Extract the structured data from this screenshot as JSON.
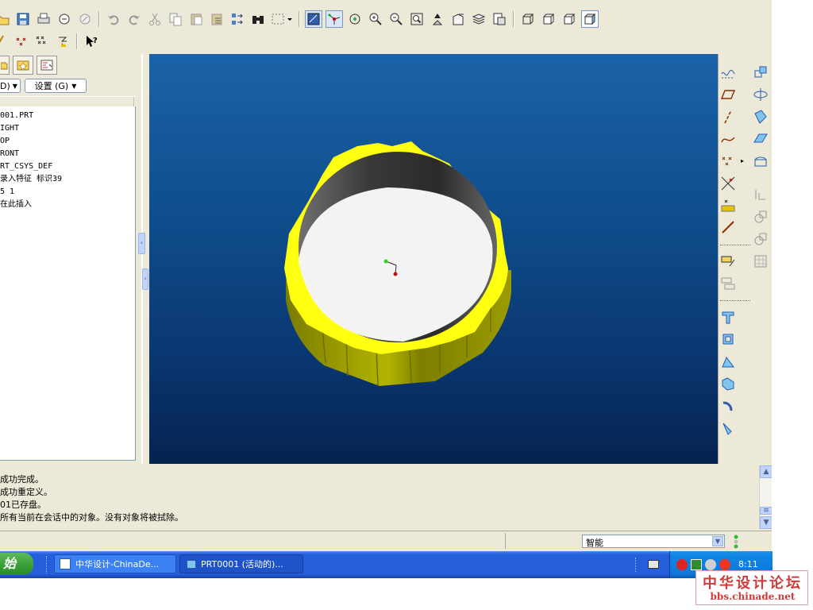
{
  "colors": {
    "viewport_top": "#1b63a8",
    "viewport_bottom": "#06234f",
    "part_yellow": "#ffff10",
    "part_olive": "#8a8c00",
    "taskbar_blue": "#245edb",
    "watermark_red": "#d23a3a"
  },
  "toolbar_top": {
    "icons": [
      "open-icon",
      "save-icon",
      "print-icon",
      "send-icon",
      "erase-icon",
      "undo-icon",
      "redo-icon",
      "cut-icon",
      "copy-icon",
      "paste-icon",
      "paste-special-icon",
      "regenerate-icon",
      "find-icon",
      "select-box-icon",
      "datum-display-icon",
      "spin-center-icon",
      "orient-mode-icon",
      "zoom-in-icon",
      "zoom-out-icon",
      "refit-icon",
      "reorient-icon",
      "view-manager-icon",
      "layers-icon",
      "saved-views-icon",
      "wireframe-icon",
      "hidden-line-icon",
      "no-hidden-icon",
      "shading-icon"
    ]
  },
  "toolbar_second": {
    "icons": [
      "datum-axis-display-icon",
      "datum-point-display-icon",
      "datum-point-symbol-icon",
      "csys-display-icon",
      "context-help-icon"
    ]
  },
  "left_panel": {
    "settings_label": "设置 (G)",
    "show_suffix": "D)",
    "tree_items": [
      "001.PRT",
      "IGHT",
      "OP",
      "RONT",
      "RT_CSYS_DEF",
      "录入特征 标识39",
      "5 1",
      "在此插入"
    ]
  },
  "messages": [
    "成功完成。",
    "成功重定义。",
    "01已存盘。",
    "所有当前在会话中的对象。没有对象将被拭除。"
  ],
  "status": {
    "filter_label": "智能"
  },
  "taskbar": {
    "start_label": "始",
    "tasks": [
      {
        "label": "中华设计-ChinaDe..."
      },
      {
        "label": "PRT0001 (活动的)..."
      }
    ],
    "clock": "8:11"
  },
  "right_toolbar": {
    "icons": [
      "sketch-datum-curve-icon",
      "datum-plane-icon",
      "datum-axis-icon",
      "datum-curve-icon",
      "datum-point-icon",
      "offset-point-icon",
      "field-point-icon",
      "datum-csys-icon",
      "sketch-tool-icon",
      "analysis-icon",
      "extrude-icon",
      "revolve-icon",
      "sweep-icon",
      "blend-icon",
      "boundary-blend-icon",
      "mirror-icon",
      "merge-icon",
      "trim-icon",
      "pattern-icon",
      "hole-icon",
      "shell-icon",
      "rib-icon",
      "draft-icon",
      "round-icon",
      "chamfer-icon"
    ]
  },
  "watermark": {
    "title": "中华设计论坛",
    "url": "bbs.chinade.net"
  }
}
